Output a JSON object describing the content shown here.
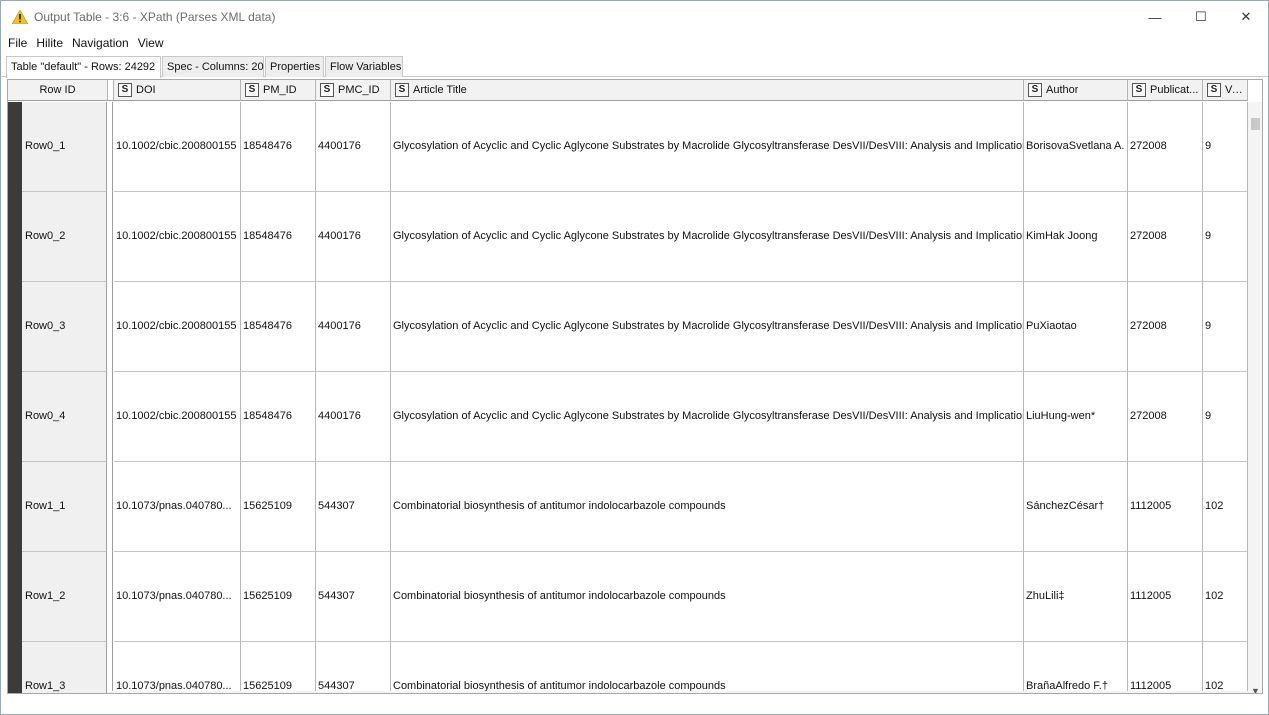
{
  "window": {
    "title": "Output Table - 3:6 - XPath (Parses XML data)",
    "controls": {
      "minimize": "—",
      "maximize": "☐",
      "close": "✕"
    }
  },
  "menu": [
    "File",
    "Hilite",
    "Navigation",
    "View"
  ],
  "tabs": [
    "Table \"default\" - Rows: 24292",
    "Spec - Columns: 20",
    "Properties",
    "Flow Variables"
  ],
  "table": {
    "rowid_header": "Row ID",
    "type_badge": "S",
    "columns": [
      "DOI",
      "PM_ID",
      "PMC_ID",
      "Article Title",
      "Author",
      "Publicat...",
      "Volur"
    ],
    "rows": [
      {
        "id": "Row0_1",
        "cells": [
          "10.1002/cbic.200800155",
          "18548476",
          "4400176",
          "Glycosylation of Acyclic and Cyclic Aglycone Substrates by Macrolide Glycosyltransferase DesVII/DesVIII: Analysis and Implications",
          "BorisovaSvetlana A.",
          "272008",
          "9"
        ]
      },
      {
        "id": "Row0_2",
        "cells": [
          "10.1002/cbic.200800155",
          "18548476",
          "4400176",
          "Glycosylation of Acyclic and Cyclic Aglycone Substrates by Macrolide Glycosyltransferase DesVII/DesVIII: Analysis and Implications",
          "KimHak Joong",
          "272008",
          "9"
        ]
      },
      {
        "id": "Row0_3",
        "cells": [
          "10.1002/cbic.200800155",
          "18548476",
          "4400176",
          "Glycosylation of Acyclic and Cyclic Aglycone Substrates by Macrolide Glycosyltransferase DesVII/DesVIII: Analysis and Implications",
          "PuXiaotao",
          "272008",
          "9"
        ]
      },
      {
        "id": "Row0_4",
        "cells": [
          "10.1002/cbic.200800155",
          "18548476",
          "4400176",
          "Glycosylation of Acyclic and Cyclic Aglycone Substrates by Macrolide Glycosyltransferase DesVII/DesVIII: Analysis and Implications",
          "LiuHung-wen*",
          "272008",
          "9"
        ]
      },
      {
        "id": "Row1_1",
        "cells": [
          "10.1073/pnas.040780...",
          "15625109",
          "544307",
          "Combinatorial biosynthesis of antitumor indolocarbazole compounds",
          "SánchezCésar†",
          "1112005",
          "102"
        ]
      },
      {
        "id": "Row1_2",
        "cells": [
          "10.1073/pnas.040780...",
          "15625109",
          "544307",
          "Combinatorial biosynthesis of antitumor indolocarbazole compounds",
          "ZhuLili‡",
          "1112005",
          "102"
        ]
      },
      {
        "id": "Row1_3",
        "cells": [
          "10.1073/pnas.040780...",
          "15625109",
          "544307",
          "Combinatorial biosynthesis of antitumor indolocarbazole compounds",
          "BrañaAlfredo F.†",
          "1112005",
          "102"
        ]
      }
    ]
  },
  "scrollbars": {
    "left_arrow": "‹",
    "right_arrow": "›",
    "down_arrow": "▼"
  },
  "colors": {
    "warning_icon": "#f0c020",
    "row_stripe": "#3b3b3b",
    "header_bg": "#f2f2f2"
  },
  "icons": {
    "title": "warning-triangle-icon"
  }
}
